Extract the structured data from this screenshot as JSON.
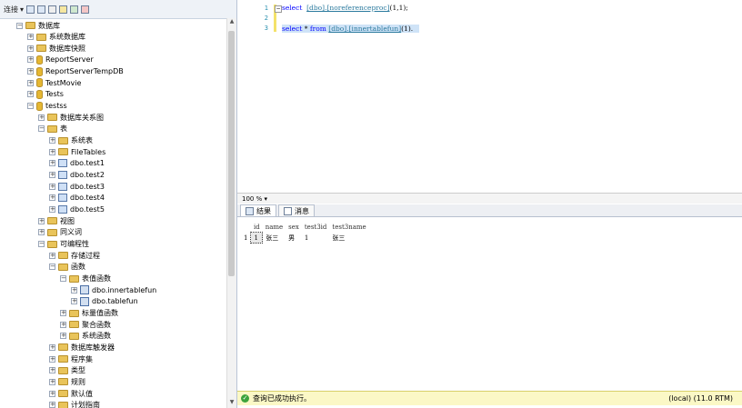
{
  "toolbar": {
    "connect_label": "连接",
    "connect_arrow": "▾"
  },
  "tree": {
    "items": [
      {
        "label": "数据库",
        "exp": "⊟",
        "icon": "folder-icon"
      },
      {
        "label": "系统数据库",
        "exp": "⊞",
        "icon": "folder-icon"
      },
      {
        "label": "数据库快照",
        "exp": "⊞",
        "icon": "folder-icon"
      },
      {
        "label": "ReportServer",
        "exp": "⊞",
        "icon": "database-icon"
      },
      {
        "label": "ReportServerTempDB",
        "exp": "⊞",
        "icon": "database-icon"
      },
      {
        "label": "TestMovie",
        "exp": "⊞",
        "icon": "database-icon"
      },
      {
        "label": "Tests",
        "exp": "⊞",
        "icon": "database-icon"
      },
      {
        "label": "testss",
        "exp": "⊟",
        "icon": "database-icon"
      },
      {
        "label": "数据库关系图",
        "exp": "⊞",
        "icon": "folder-icon"
      },
      {
        "label": "表",
        "exp": "⊟",
        "icon": "folder-icon"
      },
      {
        "label": "系统表",
        "exp": "⊞",
        "icon": "folder-icon"
      },
      {
        "label": "FileTables",
        "exp": "⊞",
        "icon": "folder-icon"
      },
      {
        "label": "dbo.test1",
        "exp": "⊞",
        "icon": "table-icon"
      },
      {
        "label": "dbo.test2",
        "exp": "⊞",
        "icon": "table-icon"
      },
      {
        "label": "dbo.test3",
        "exp": "⊞",
        "icon": "table-icon"
      },
      {
        "label": "dbo.test4",
        "exp": "⊞",
        "icon": "table-icon"
      },
      {
        "label": "dbo.test5",
        "exp": "⊞",
        "icon": "table-icon"
      },
      {
        "label": "视图",
        "exp": "⊞",
        "icon": "folder-icon"
      },
      {
        "label": "同义词",
        "exp": "⊞",
        "icon": "folder-icon"
      },
      {
        "label": "可编程性",
        "exp": "⊟",
        "icon": "folder-icon"
      },
      {
        "label": "存储过程",
        "exp": "⊞",
        "icon": "folder-icon"
      },
      {
        "label": "函数",
        "exp": "⊟",
        "icon": "folder-icon"
      },
      {
        "label": "表值函数",
        "exp": "⊟",
        "icon": "folder-icon"
      },
      {
        "label": "dbo.innertablefun",
        "exp": "⊞",
        "icon": "function-icon"
      },
      {
        "label": "dbo.tablefun",
        "exp": "⊞",
        "icon": "function-icon"
      },
      {
        "label": "标量值函数",
        "exp": "⊞",
        "icon": "folder-icon"
      },
      {
        "label": "聚合函数",
        "exp": "⊞",
        "icon": "folder-icon"
      },
      {
        "label": "系统函数",
        "exp": "⊞",
        "icon": "folder-icon"
      },
      {
        "label": "数据库触发器",
        "exp": "⊞",
        "icon": "folder-icon"
      },
      {
        "label": "程序集",
        "exp": "⊞",
        "icon": "folder-icon"
      },
      {
        "label": "类型",
        "exp": "⊞",
        "icon": "folder-icon"
      },
      {
        "label": "规则",
        "exp": "⊞",
        "icon": "folder-icon"
      },
      {
        "label": "默认值",
        "exp": "⊞",
        "icon": "folder-icon"
      },
      {
        "label": "计划指南",
        "exp": "⊞",
        "icon": "folder-icon"
      }
    ]
  },
  "editor": {
    "line_numbers": [
      "1",
      "2",
      "3"
    ],
    "line1": {
      "kw": "select",
      "obj": "[dbo].[noreferenceproc]",
      "args": "(1,1);"
    },
    "line3": {
      "kw1": "select",
      "star": " * ",
      "kw2": "from",
      "obj": "[dbo].[innertablefun]",
      "args": "(1)."
    }
  },
  "zoom": {
    "value": "100 %",
    "arrow": "▾"
  },
  "tabs": [
    {
      "label": "结果",
      "icon": "grid-icon"
    },
    {
      "label": "消息",
      "icon": "message-icon"
    }
  ],
  "results": {
    "columns": [
      "id",
      "name",
      "sex",
      "test3id",
      "test3name"
    ],
    "rows": [
      {
        "rownum": "1",
        "cells": [
          "1",
          "张三",
          "男",
          "1",
          "张三"
        ]
      }
    ]
  },
  "status": {
    "message": "查询已成功执行。",
    "server": "(local) (11.0 RTM)"
  },
  "colors": {
    "status_bg": "#fbf8c6",
    "selection": "#cfe3f7",
    "keyword": "#0000ff"
  }
}
